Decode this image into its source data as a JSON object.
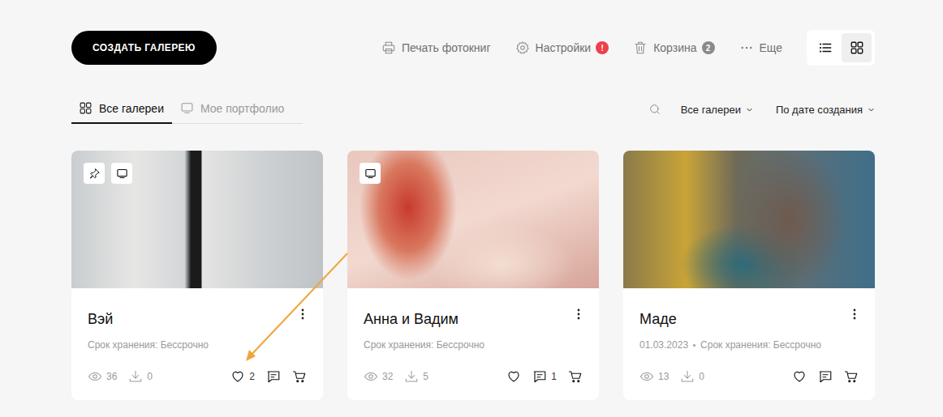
{
  "header": {
    "create_button": "СОЗДАТЬ ГАЛЕРЕЮ"
  },
  "toolbar": [
    {
      "kind": "print",
      "label": "Печать фотокниг"
    },
    {
      "kind": "settings",
      "label": "Настройки",
      "badge": "!",
      "badge_color": "#ee3f4c"
    },
    {
      "kind": "trash",
      "label": "Корзина",
      "badge": "2",
      "badge_color": "#8a8a8a"
    },
    {
      "kind": "more",
      "label": "Еще"
    }
  ],
  "view_switcher": [
    {
      "kind": "list",
      "selected": false
    },
    {
      "kind": "grid",
      "selected": true
    }
  ],
  "tabs": [
    {
      "kind": "galleries",
      "label": "Все галереи",
      "selected": true
    },
    {
      "kind": "portfolio",
      "label": "Мое портфолио",
      "selected": false
    }
  ],
  "filters": [
    "Все галереи",
    "По дате создания"
  ],
  "cards": [
    {
      "title": "Вэй",
      "meta": [
        "Срок хранения: Бессрочно"
      ],
      "pinned": true,
      "portfolio": true,
      "views": "36",
      "downloads": "0",
      "likes": "2"
    },
    {
      "title": "Анна и Вадим",
      "meta": [
        "Срок хранения: Бессрочно"
      ],
      "pinned": false,
      "portfolio": true,
      "views": "32",
      "downloads": "5",
      "comments": "1"
    },
    {
      "title": "Маде",
      "meta": [
        "01.03.2023",
        "Срок хранения: Бессрочно"
      ],
      "pinned": false,
      "portfolio": false,
      "views": "13",
      "downloads": "0"
    }
  ]
}
